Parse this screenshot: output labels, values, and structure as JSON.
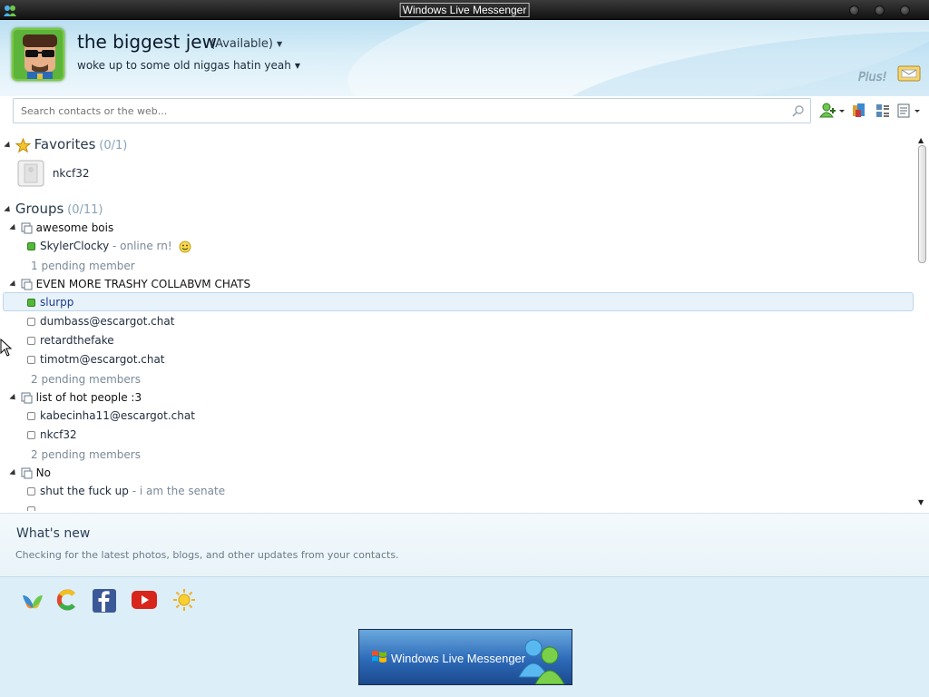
{
  "window": {
    "title": "Windows Live Messenger"
  },
  "profile": {
    "display_name": "the biggest jew",
    "status": "(Available)",
    "personal_message": "woke up to some old niggas hatin yeah"
  },
  "search": {
    "placeholder": "Search contacts or the web..."
  },
  "favorites": {
    "title": "Favorites",
    "count": "(0/1)",
    "contacts": [
      {
        "name": "nkcf32"
      }
    ]
  },
  "groups": {
    "title": "Groups",
    "count": "(0/11)",
    "list": [
      {
        "name": "awesome bois",
        "members": [
          {
            "name": "SkylerClocky",
            "separator": " - ",
            "message": "online rn!",
            "status": "online"
          }
        ],
        "pending": "1 pending member"
      },
      {
        "name": "EVEN MORE TRASHY COLLABVM CHATS",
        "members": [
          {
            "name": "slurpp",
            "status": "online"
          },
          {
            "name": "dumbass@escargot.chat",
            "status": "offline"
          },
          {
            "name": "retardthefake",
            "status": "offline"
          },
          {
            "name": "timotm@escargot.chat",
            "status": "offline"
          }
        ],
        "pending": "2 pending members"
      },
      {
        "name": "list of hot people :3",
        "members": [
          {
            "name": "kabecinha11@escargot.chat",
            "status": "offline"
          },
          {
            "name": "nkcf32",
            "status": "offline"
          }
        ],
        "pending": "2 pending members"
      },
      {
        "name": "No",
        "members": [
          {
            "name": "shut the fuck up",
            "separator": " - ",
            "message": "i am the senate",
            "status": "offline"
          }
        ]
      }
    ]
  },
  "whats_new": {
    "title": "What's new",
    "text": "Checking for the latest photos, blogs, and other updates from your contacts."
  },
  "ad": {
    "text": "Windows Live Messenger"
  },
  "plus_logo": {
    "text": "Plus!"
  },
  "colors": {
    "online": "#52b83a",
    "accent": "#b9def1",
    "selected": "#e8f2fb"
  }
}
